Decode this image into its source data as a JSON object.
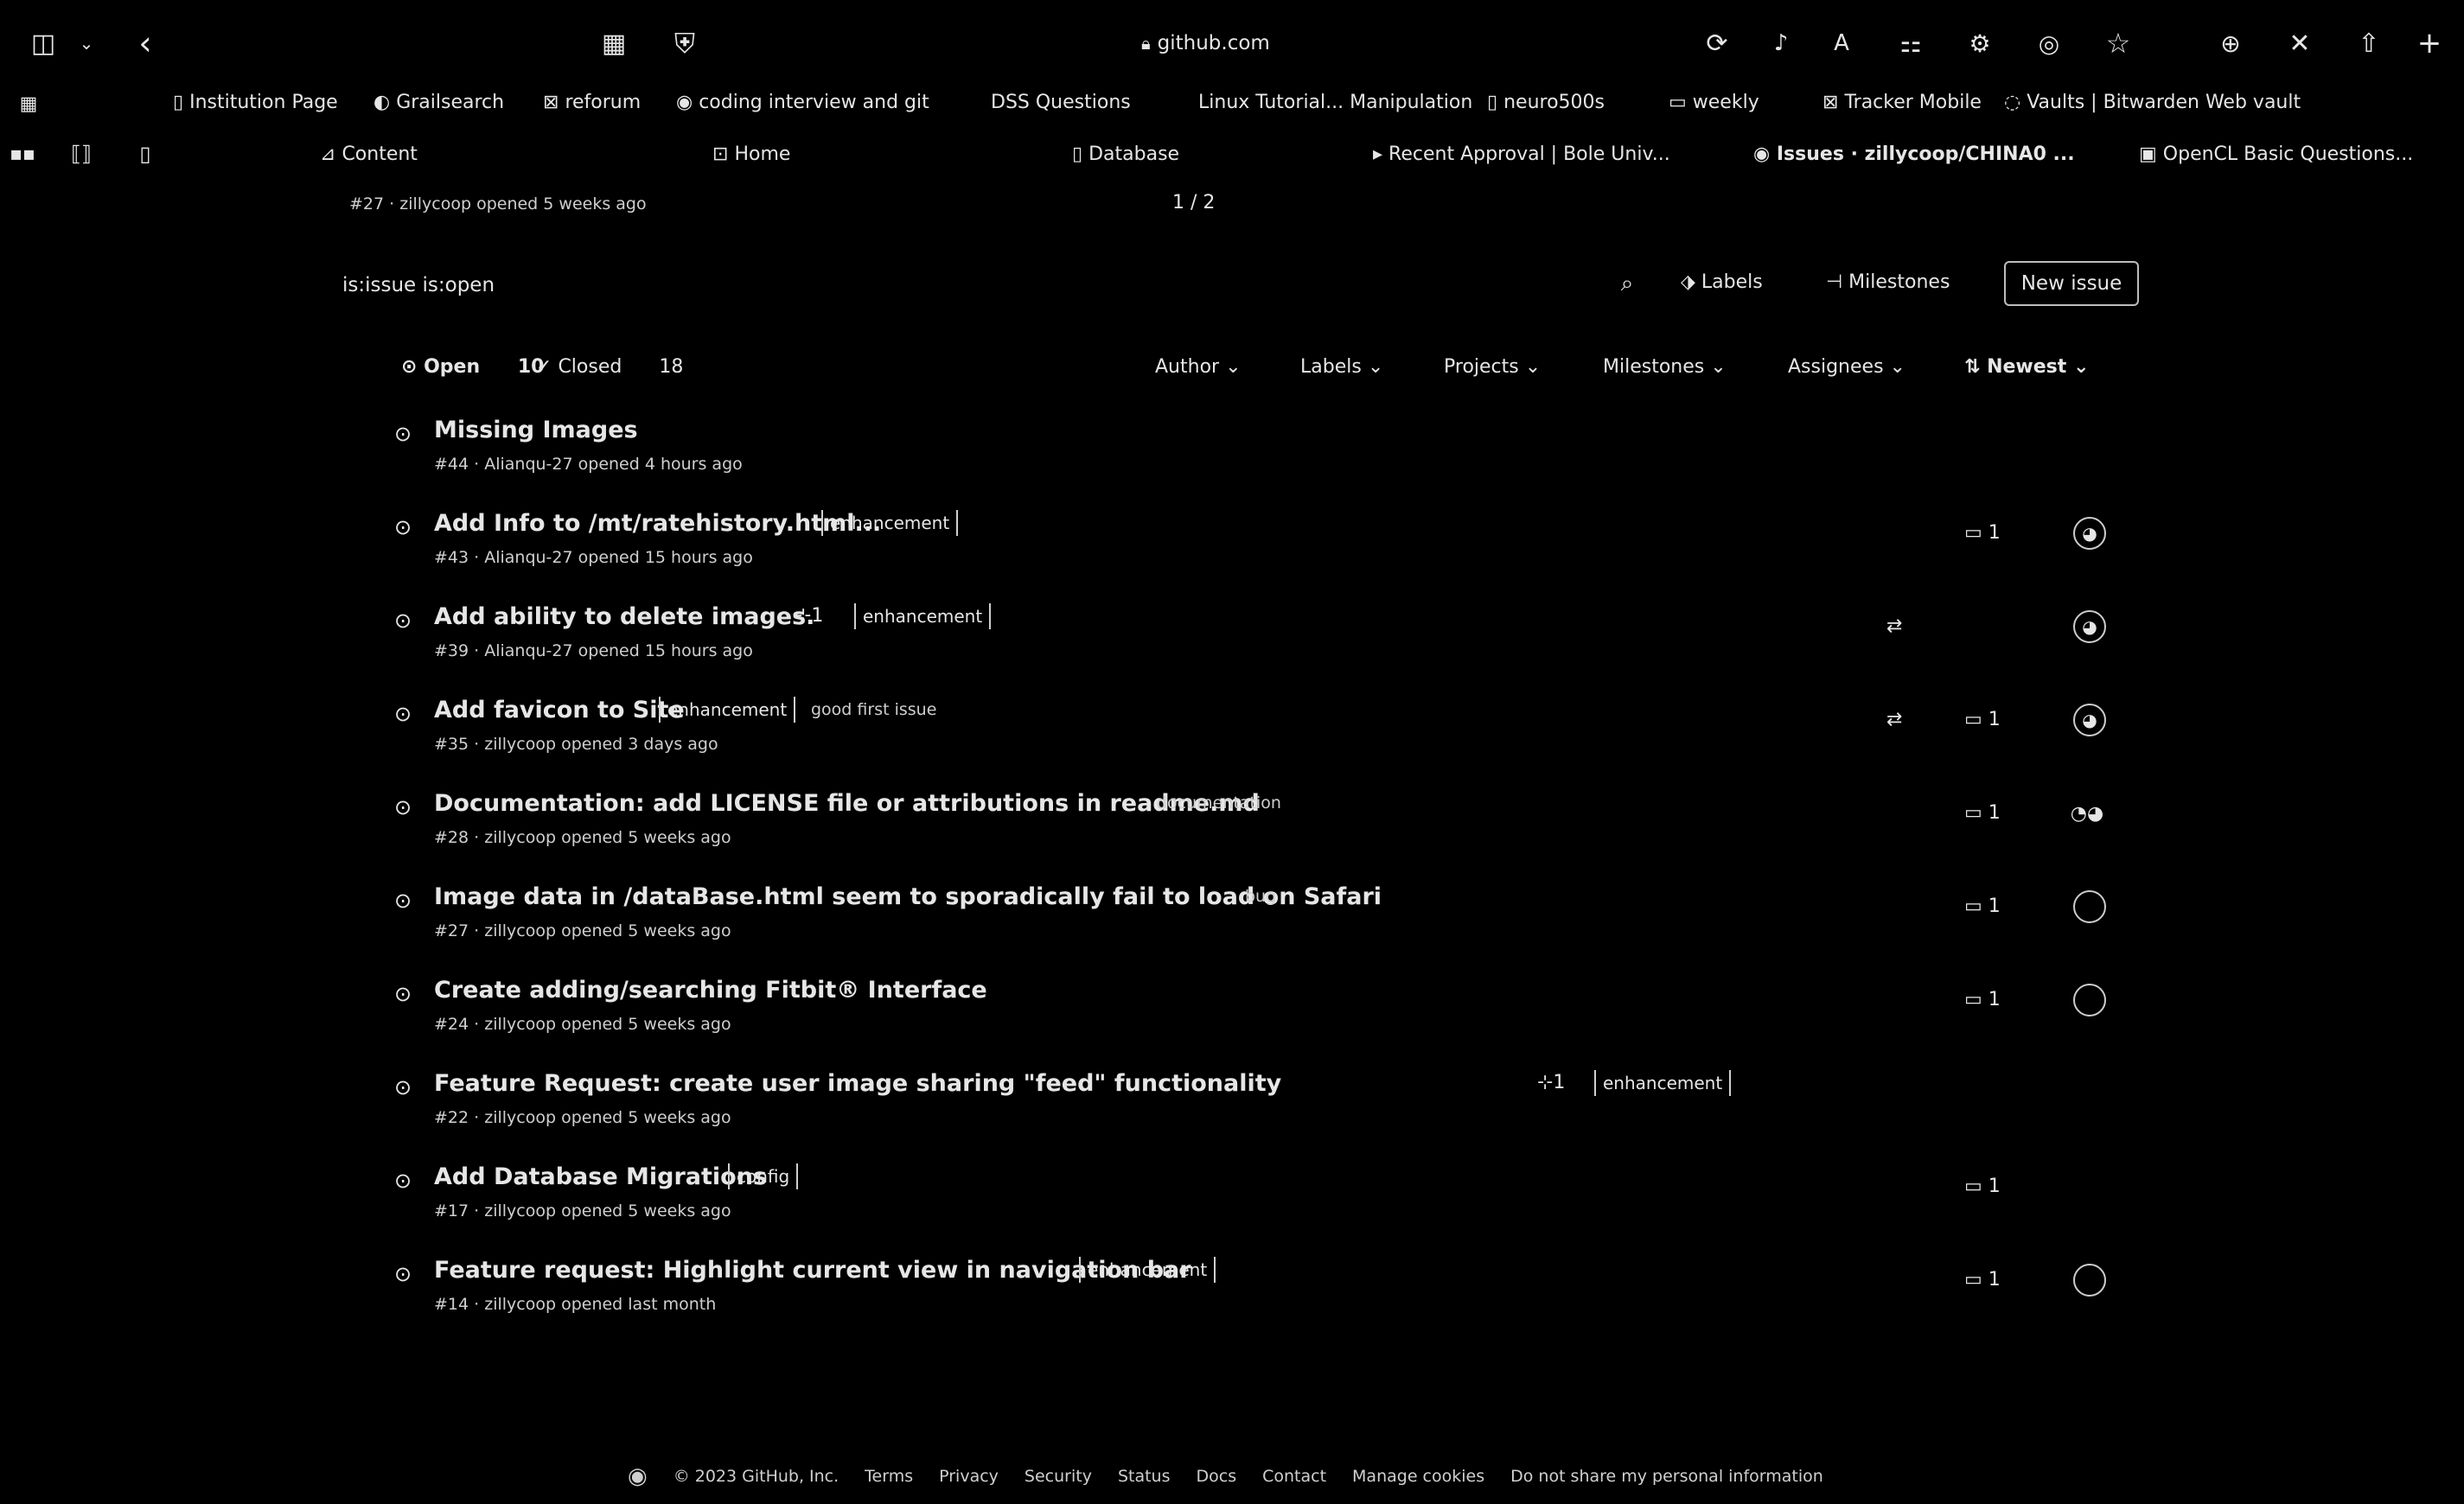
{
  "browser": {
    "url": "github.com",
    "bookmarks": [
      "Institution Page",
      "Grailsearch",
      "reforum",
      "coding interview and git",
      "DSS Questions",
      "Linux Tutorial... Manipulation",
      "neuro500s",
      "weekly",
      "Tracker Mobile",
      "Vaults | Bitwarden Web vault"
    ],
    "tabs": [
      "Content",
      "Home",
      "Database",
      "Recent Approval | Bole Univ...",
      "Issues · zillycoop/CHINA0 ...",
      "OpenCL Basic Questions..."
    ]
  },
  "repo_header": {
    "subtitle": "#27 · zillycoop opened 5 weeks ago",
    "pager": "1 / 2"
  },
  "toolbar": {
    "search_value": "is:issue is:open",
    "labels_label": "Labels",
    "milestones_label": "Milestones",
    "new_issue_label": "New issue"
  },
  "filters": {
    "open_label": "Open",
    "open_count": "10",
    "closed_label": "Closed",
    "closed_count": "18",
    "author": "Author",
    "labels": "Labels",
    "projects": "Projects",
    "milestones": "Milestones",
    "assignees": "Assignees",
    "sort": "Newest"
  },
  "issues": [
    {
      "title": "Missing Images",
      "meta": "#44 · Alianqu-27 opened 4 hours ago",
      "labels": [],
      "count": "",
      "avatar": false,
      "linked": false
    },
    {
      "title": "Add Info to /mt/ratehistory.html...",
      "meta": "#43 · Alianqu-27 opened 15 hours ago",
      "labels": [
        "enhancement"
      ],
      "count": "1",
      "avatar": true,
      "linked": false
    },
    {
      "title": "Add ability to delete images.",
      "meta": "#39 · Alianqu-27 opened 15 hours ago",
      "labels": [
        "enhancement"
      ],
      "count": "",
      "avatar": true,
      "linked": true
    },
    {
      "title": "Add favicon to Site",
      "meta": "#35 · zillycoop opened 3 days ago",
      "labels": [
        "enhancement",
        "good first issue"
      ],
      "count": "1",
      "avatar": true,
      "linked": true
    },
    {
      "title": "Documentation: add LICENSE file or attributions in readme.md",
      "meta": "#28 · zillycoop opened 5 weeks ago",
      "labels": [
        "documentation"
      ],
      "count": "1",
      "avatar": true,
      "linked": false
    },
    {
      "title": "Image data in /dataBase.html seem to sporadically fail to load on Safari",
      "meta": "#27 · zillycoop opened 5 weeks ago",
      "labels": [
        "bug"
      ],
      "count": "1",
      "avatar": true,
      "linked": false
    },
    {
      "title": "Create adding/searching Fitbit® Interface",
      "meta": "#24 · zillycoop opened 5 weeks ago",
      "labels": [],
      "count": "1",
      "avatar": true,
      "linked": false
    },
    {
      "title": "Feature Request: create user image sharing \"feed\" functionality",
      "meta": "#22 · zillycoop opened 5 weeks ago",
      "labels": [
        "enhancement"
      ],
      "count": "",
      "avatar": false,
      "linked": false
    },
    {
      "title": "Add Database Migrations",
      "meta": "#17 · zillycoop opened 5 weeks ago",
      "labels": [
        "config"
      ],
      "count": "1",
      "avatar": false,
      "linked": false
    },
    {
      "title": "Feature request: Highlight current view in navigation bar",
      "meta": "#14 · zillycoop opened last month",
      "labels": [
        "enhancement"
      ],
      "count": "1",
      "avatar": true,
      "linked": false
    }
  ],
  "footer": {
    "copyright": "© 2023 GitHub, Inc.",
    "links": [
      "Terms",
      "Privacy",
      "Security",
      "Status",
      "Docs",
      "Contact",
      "Manage cookies",
      "Do not share my personal information"
    ]
  }
}
